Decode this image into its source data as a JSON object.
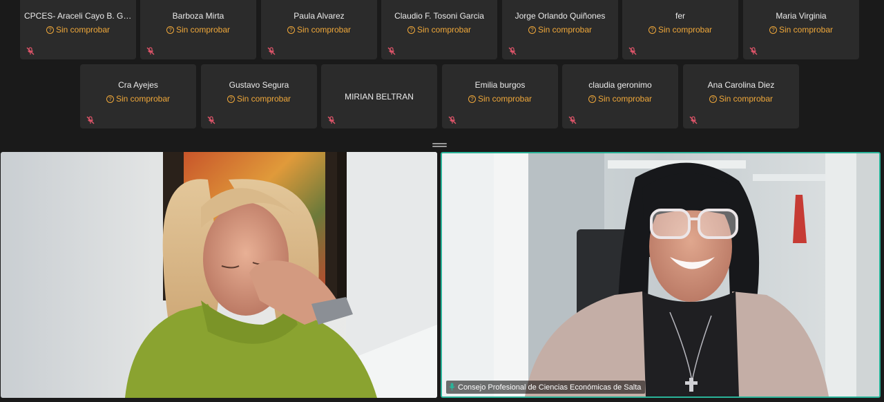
{
  "participants_row1": [
    {
      "name": "CPCES- Araceli Cayo B. Gon...",
      "status": "Sin comprobar"
    },
    {
      "name": "Barboza Mirta",
      "status": "Sin comprobar"
    },
    {
      "name": "Paula Alvarez",
      "status": "Sin comprobar"
    },
    {
      "name": "Claudio F. Tosoni Garcia",
      "status": "Sin comprobar"
    },
    {
      "name": "Jorge Orlando Quiñones",
      "status": "Sin comprobar"
    },
    {
      "name": "fer",
      "status": "Sin comprobar"
    },
    {
      "name": "Maria Virginia",
      "status": "Sin comprobar"
    }
  ],
  "participants_row2": [
    {
      "name": "Cra  Ayejes",
      "status": "Sin comprobar"
    },
    {
      "name": "Gustavo Segura",
      "status": "Sin comprobar"
    },
    {
      "name": "MIRIAN BELTRAN",
      "status": ""
    },
    {
      "name": "Emilia burgos",
      "status": "Sin comprobar"
    },
    {
      "name": "claudia geronimo",
      "status": "Sin comprobar"
    },
    {
      "name": "Ana Carolina Diez",
      "status": "Sin comprobar"
    }
  ],
  "videos": {
    "right_label": "Consejo Profesional de Ciencias Económicas de Salta"
  },
  "colors": {
    "status": "#f0a83a",
    "active_speaker_border": "#2ab49a",
    "muted_mic": "#e0556a",
    "tile_bg": "#2b2b2b"
  },
  "icons": {
    "status": "question-circle-icon",
    "muted": "mic-muted-icon",
    "active_mic": "mic-on-icon"
  }
}
